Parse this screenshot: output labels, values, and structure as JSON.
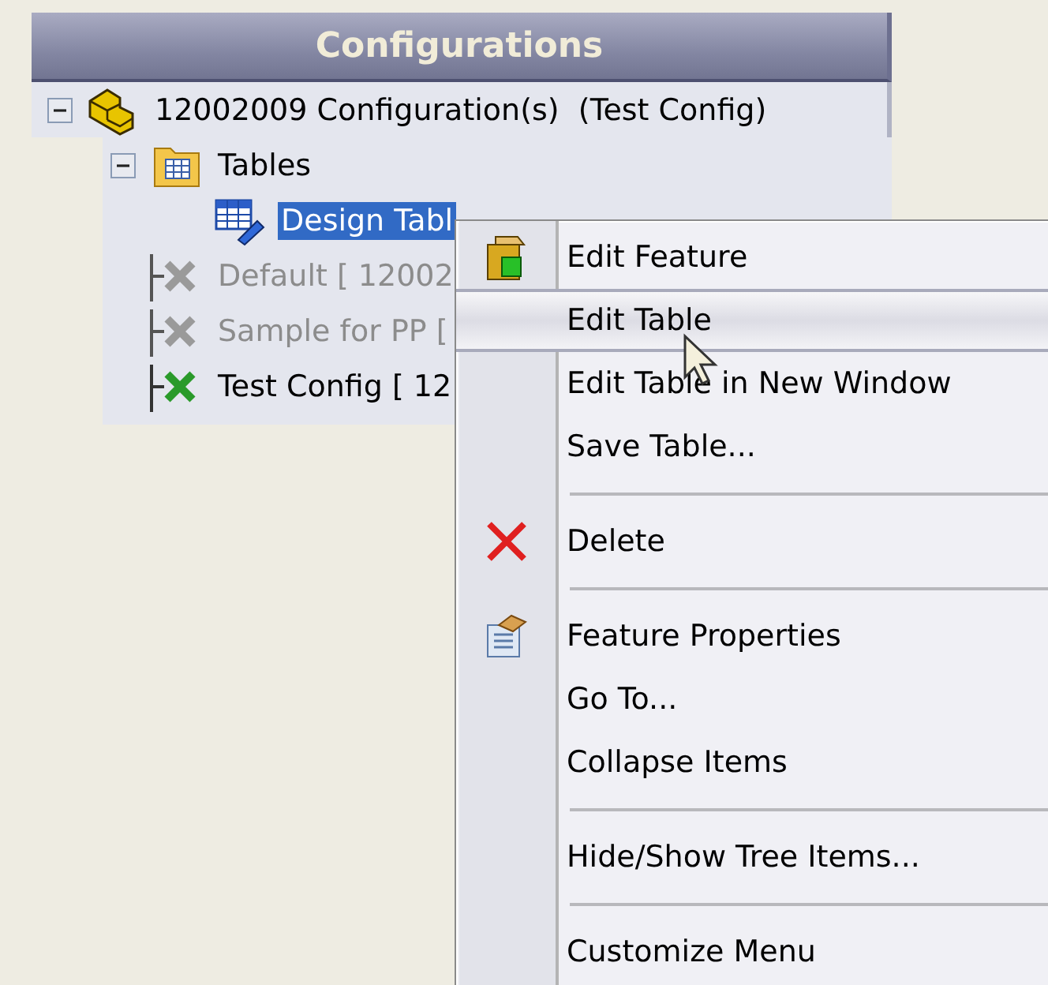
{
  "panel": {
    "title": "Configurations"
  },
  "tree": [
    {
      "label": "12002009 Configuration(s)  (Test Config)",
      "kind": "part",
      "expanded": true,
      "selected": false,
      "disabled": false,
      "children": [
        {
          "label": "Tables",
          "kind": "folder",
          "expanded": true,
          "selected": false,
          "disabled": false,
          "children": [
            {
              "label": "Design Tabl",
              "kind": "design-table",
              "selected": true,
              "disabled": false
            }
          ]
        },
        {
          "label": "Default [ 12002",
          "kind": "configuration",
          "selected": false,
          "disabled": true
        },
        {
          "label": "Sample for PP [",
          "kind": "configuration",
          "selected": false,
          "disabled": true
        },
        {
          "label": "Test Config [ 12",
          "kind": "configuration",
          "selected": false,
          "disabled": false
        }
      ]
    }
  ],
  "context_menu": [
    {
      "kind": "item",
      "label": "Edit Feature",
      "selected": false
    },
    {
      "kind": "item",
      "label": "Edit Table",
      "selected": true
    },
    {
      "kind": "item",
      "label": "Edit Table in New Window",
      "selected": false
    },
    {
      "kind": "item",
      "label": "Save Table...",
      "selected": false
    },
    {
      "kind": "separator"
    },
    {
      "kind": "item",
      "label": "Delete",
      "selected": false
    },
    {
      "kind": "separator"
    },
    {
      "kind": "item",
      "label": "Feature Properties",
      "selected": false
    },
    {
      "kind": "item",
      "label": "Go To...",
      "selected": false
    },
    {
      "kind": "item",
      "label": "Collapse Items",
      "selected": false
    },
    {
      "kind": "separator"
    },
    {
      "kind": "item",
      "label": "Hide/Show Tree Items...",
      "selected": false
    },
    {
      "kind": "separator"
    },
    {
      "kind": "item",
      "label": "Customize Menu",
      "selected": false
    }
  ]
}
